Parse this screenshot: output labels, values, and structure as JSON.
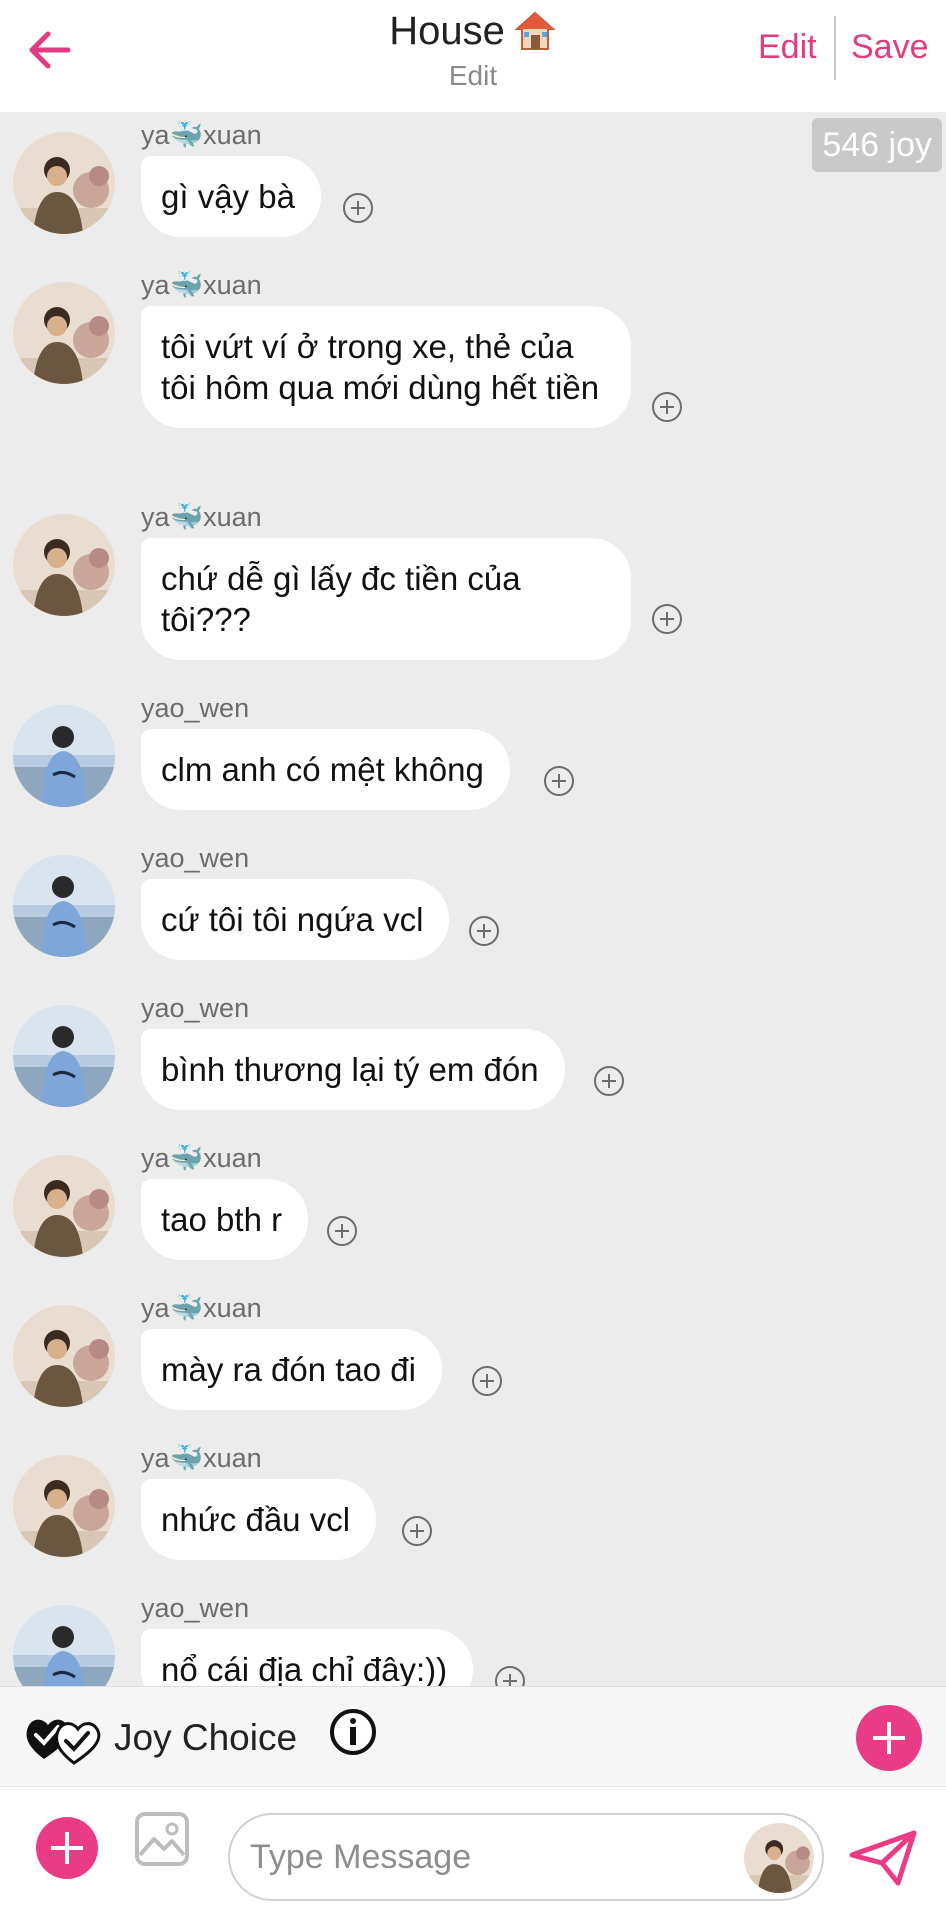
{
  "header": {
    "title": "House",
    "title_emoji_icon": "house-icon",
    "subtitle": "Edit",
    "edit_label": "Edit",
    "save_label": "Save",
    "accent_color": "#e23b82"
  },
  "joy_balance": "546 joy",
  "messages": [
    {
      "user": "ya🐳xuan",
      "text": "gì vậy bà",
      "avatar": "xuan"
    },
    {
      "user": "ya🐳xuan",
      "text": "tôi vứt ví ở trong xe, thẻ của tôi hôm qua mới dùng hết tiền",
      "avatar": "xuan"
    },
    {
      "user": "ya🐳xuan",
      "text": "chứ dễ gì lấy đc tiền của tôi???",
      "avatar": "xuan"
    },
    {
      "user": "yao_wen",
      "text": "clm anh có mệt không",
      "avatar": "wen"
    },
    {
      "user": "yao_wen",
      "text": "cứ tôi tôi ngứa vcl",
      "avatar": "wen"
    },
    {
      "user": "yao_wen",
      "text": "bình thương lại tý em đón",
      "avatar": "wen"
    },
    {
      "user": "ya🐳xuan",
      "text": "tao bth r",
      "avatar": "xuan"
    },
    {
      "user": "ya🐳xuan",
      "text": "mày ra đón tao đi",
      "avatar": "xuan"
    },
    {
      "user": "ya🐳xuan",
      "text": "nhức đầu vcl",
      "avatar": "xuan"
    },
    {
      "user": "yao_wen",
      "text": "nổ cái địa chỉ đây:))",
      "avatar": "wen"
    }
  ],
  "joy_choice": {
    "label": "Joy Choice"
  },
  "composer": {
    "placeholder": "Type Message"
  },
  "colors": {
    "brand_pink": "#ea3c86",
    "chat_background": "#ececec",
    "bubble": "#ffffff"
  }
}
